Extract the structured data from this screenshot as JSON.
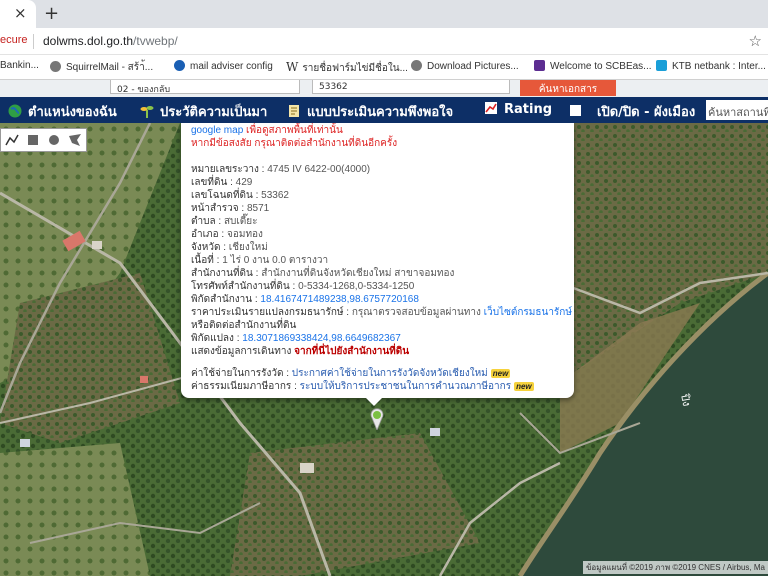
{
  "browser": {
    "tab_close": "×",
    "new_tab": "+",
    "security": "ecure",
    "url_host": "dolwms.dol.go.th",
    "url_path": "/tvwebp/",
    "bookmarks": [
      {
        "label": "Bankin...",
        "icon": "bank-icon",
        "color": "#1c6bb5"
      },
      {
        "label": "SquirrelMail - สร้า้...",
        "icon": "globe-icon",
        "color": "#666666"
      },
      {
        "label": "mail adviser config",
        "icon": "globe-icon",
        "color": "#1a5fb4"
      },
      {
        "label": "รายชื่อฟาร์มไข่มีชื่อใน...",
        "icon": "wikipedia-icon",
        "color": "#000000"
      },
      {
        "label": "Download Pictures...",
        "icon": "globe-icon",
        "color": "#666666"
      },
      {
        "label": "Welcome to SCBEas...",
        "icon": "scb-icon",
        "color": "#5c2d91"
      },
      {
        "label": "KTB netbank : Inter...",
        "icon": "ktb-icon",
        "color": "#1a9fd8"
      }
    ]
  },
  "page_top": {
    "field_a": "02 - ของกลับ",
    "field_b": "53362",
    "button": "ค้นหาเอกสาร"
  },
  "nav": {
    "items": [
      {
        "label": "ตำแหน่งของฉัน",
        "icon": "globe-icon"
      },
      {
        "label": "ประวัติความเป็นมา",
        "icon": "sprout-icon"
      },
      {
        "label": "แบบประเมินความพึงพอใจ",
        "icon": "document-icon"
      },
      {
        "label": "Rating",
        "icon": "chart-icon"
      },
      {
        "label": "เปิด/ปิด - ผังเมือง",
        "icon": "checkbox-icon"
      }
    ],
    "search_placeholder": "ค้นหาสถานที่ส"
  },
  "popup": {
    "header_link": "google map",
    "header_note": "เพื่อดูสภาพพื้นที่เท่านั้น",
    "warning": "หากมีข้อสงสัย กรุณาติดต่อสำนักงานที่ดินอีกครั้ง",
    "fields": [
      {
        "label": "หมายเลขระวาง :",
        "value": "4745 IV 6422-00(4000)"
      },
      {
        "label": "เลขที่ดิน :",
        "value": "429"
      },
      {
        "label": "เลขโฉนดที่ดิน :",
        "value": "53362"
      },
      {
        "label": "หน้าสำรวจ :",
        "value": "8571"
      },
      {
        "label": "ตำบล :",
        "value": "สบเตี๊ยะ"
      },
      {
        "label": "อำเภอ :",
        "value": "จอมทอง"
      },
      {
        "label": "จังหวัด :",
        "value": "เชียงใหม่"
      },
      {
        "label": "เนื้อที่ :",
        "value": "1 ไร่ 0 งาน 0.0 ตารางวา"
      },
      {
        "label": "สำนักงานที่ดิน :",
        "value": "สำนักงานที่ดินจังหวัดเชียงใหม่ สาขาจอมทอง"
      },
      {
        "label": "โทรศัพท์สำนักงานที่ดิน :",
        "value": "0-5334-1268,0-5334-1250"
      }
    ],
    "office_coord_label": "พิกัดสำนักงาน :",
    "office_coord": "18.4167471489238,98.6757720168",
    "price_label": "ราคาประเมินรายแปลงกรมธนารักษ์ :",
    "price_text": "กรุณาตรวจสอบข้อมูลผ่านทาง",
    "price_link": "เว็บไซต์กรมธนารักษ์",
    "price_line2": "หรือติดต่อสำนักงานที่ดิน",
    "parcel_coord_label": "พิกัดแปลง :",
    "parcel_coord": "18.3071869338424,98.6649682367",
    "route_label": "แสดงข้อมูลการเดินทาง",
    "route_link": "จากที่นี่ไปยังสำนักงานที่ดิน",
    "fee_label": "ค่าใช้จ่ายในการรังวัด :",
    "fee_link": "ประกาศค่าใช้จ่ายในการรังวัดจังหวัดเชียงใหม่",
    "tax_label": "ค่าธรรมเนียมภาษีอากร :",
    "tax_link": "ระบบให้บริการประชาชนในการคำนวณภาษีอากร",
    "new_badge": "new"
  },
  "map": {
    "river_label": "ปิง",
    "attribution": "ข้อมูลแผนที่ ©2019 ภาพ ©2019 CNES / Airbus, Ma"
  },
  "colors": {
    "nav_bg": "#0d2f66",
    "search_button": "#e6583a",
    "river": "#2e4a3c"
  }
}
